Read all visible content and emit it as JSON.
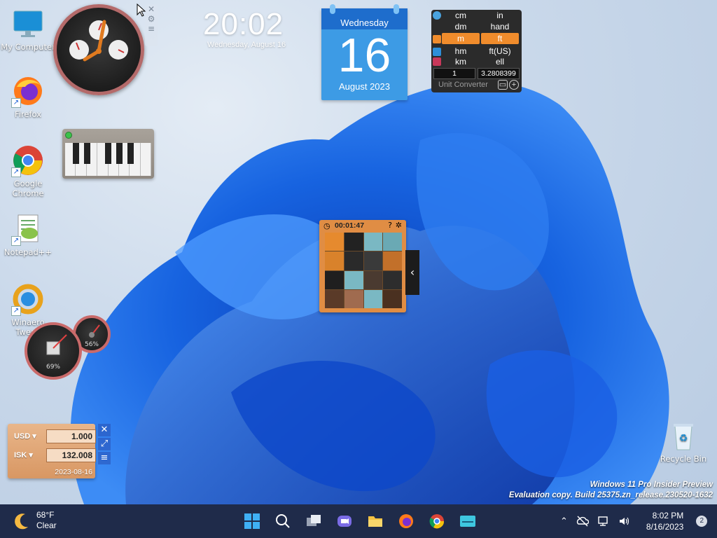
{
  "desktop_icons": [
    {
      "label": "My Computer",
      "icon": "monitor-icon"
    },
    {
      "label": "Firefox",
      "icon": "firefox-icon"
    },
    {
      "label": "Google Chrome",
      "icon": "chrome-icon"
    },
    {
      "label": "Notepad++",
      "icon": "notepadpp-icon"
    },
    {
      "label": "Winaero Tweak",
      "icon": "winaero-icon"
    },
    {
      "label": "Recycle Bin",
      "icon": "recycle-bin-icon"
    }
  ],
  "digital_clock": {
    "time": "20:02",
    "date": "Wednesday, August 16"
  },
  "calendar": {
    "weekday": "Wednesday",
    "day": "16",
    "month_year": "August 2023"
  },
  "unit_converter": {
    "rows": [
      [
        "cm",
        "in"
      ],
      [
        "dm",
        "hand"
      ],
      [
        "m",
        "ft"
      ],
      [
        "hm",
        "ft(US)"
      ],
      [
        "km",
        "ell"
      ]
    ],
    "selected_row": 2,
    "input_left": "1",
    "input_right": "3.2808399",
    "title": "Unit Converter"
  },
  "puzzle": {
    "timer": "00:01:47"
  },
  "meters": {
    "cpu_percent": "69%",
    "memory_percent": "56%"
  },
  "currency": {
    "from_code": "USD",
    "from_value": "1.000",
    "to_code": "ISK",
    "to_value": "132.008",
    "date": "2023-08-16"
  },
  "watermark": {
    "line1": "Windows 11 Pro Insider Preview",
    "line2": "Evaluation copy. Build 25375.zn_release.230520-1632"
  },
  "taskbar": {
    "weather_temp": "68°F",
    "weather_desc": "Clear",
    "time": "8:02 PM",
    "date": "8/16/2023",
    "notifications": "2"
  },
  "colors": {
    "accent": "#1e6dcc",
    "taskbar": "#1f2b4a",
    "orange": "#f08c2c"
  }
}
